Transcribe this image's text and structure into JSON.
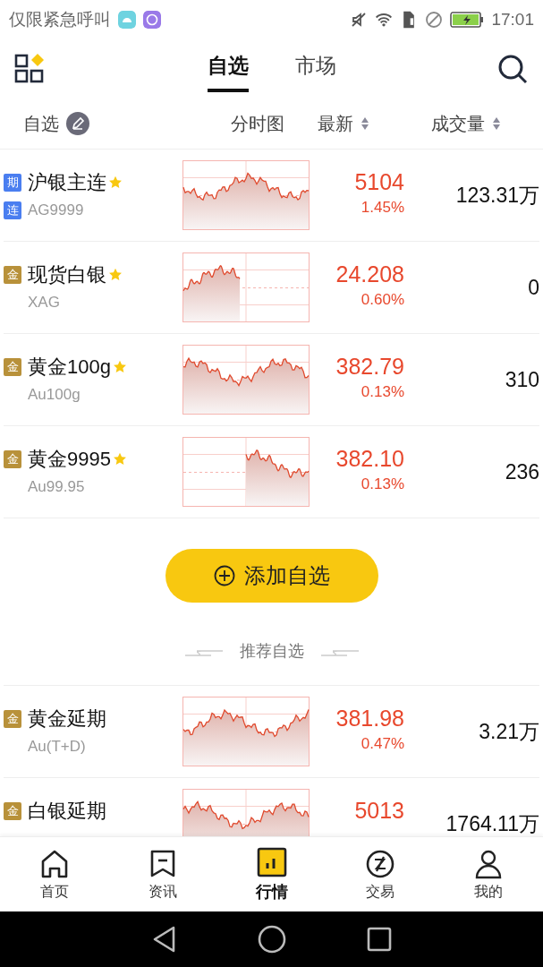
{
  "status_bar": {
    "carrier": "仅限紧急呼叫",
    "time": "17:01"
  },
  "header": {
    "tabs": [
      {
        "label": "自选",
        "selected": true
      },
      {
        "label": "市场",
        "selected": false
      }
    ]
  },
  "columns": {
    "watchlist": "自选",
    "chart": "分时图",
    "latest": "最新",
    "volume": "成交量"
  },
  "rows": [
    {
      "tags": [
        {
          "text": "期",
          "color": "#4a7ef0"
        },
        {
          "text": "连",
          "color": "#4a7ef0"
        }
      ],
      "name": "沪银主连",
      "code": "AG9999",
      "starred": true,
      "price": "5104",
      "change": "1.45%",
      "volume": "123.31万"
    },
    {
      "tags": [
        {
          "text": "金",
          "color": "#b8913a"
        }
      ],
      "name": "现货白银",
      "code": "XAG",
      "starred": true,
      "price": "24.208",
      "change": "0.60%",
      "volume": "0"
    },
    {
      "tags": [
        {
          "text": "金",
          "color": "#b8913a"
        }
      ],
      "name": "黄金100g",
      "code": "Au100g",
      "starred": true,
      "price": "382.79",
      "change": "0.13%",
      "volume": "310"
    },
    {
      "tags": [
        {
          "text": "金",
          "color": "#b8913a"
        }
      ],
      "name": "黄金9995",
      "code": "Au99.95",
      "starred": true,
      "price": "382.10",
      "change": "0.13%",
      "volume": "236"
    }
  ],
  "add_button": "添加自选",
  "recommend_title": "推荐自选",
  "recommended": [
    {
      "tags": [
        {
          "text": "金",
          "color": "#b8913a"
        }
      ],
      "name": "黄金延期",
      "code": "Au(T+D)",
      "starred": false,
      "price": "381.98",
      "change": "0.47%",
      "volume": "3.21万"
    },
    {
      "tags": [
        {
          "text": "金",
          "color": "#b8913a"
        }
      ],
      "name": "白银延期",
      "starred": false,
      "price": "5013",
      "volume": "1764.11万"
    }
  ],
  "bottom_nav": [
    {
      "label": "首页",
      "selected": false
    },
    {
      "label": "资讯",
      "selected": false
    },
    {
      "label": "行情",
      "selected": true
    },
    {
      "label": "交易",
      "selected": false
    },
    {
      "label": "我的",
      "selected": false
    }
  ]
}
